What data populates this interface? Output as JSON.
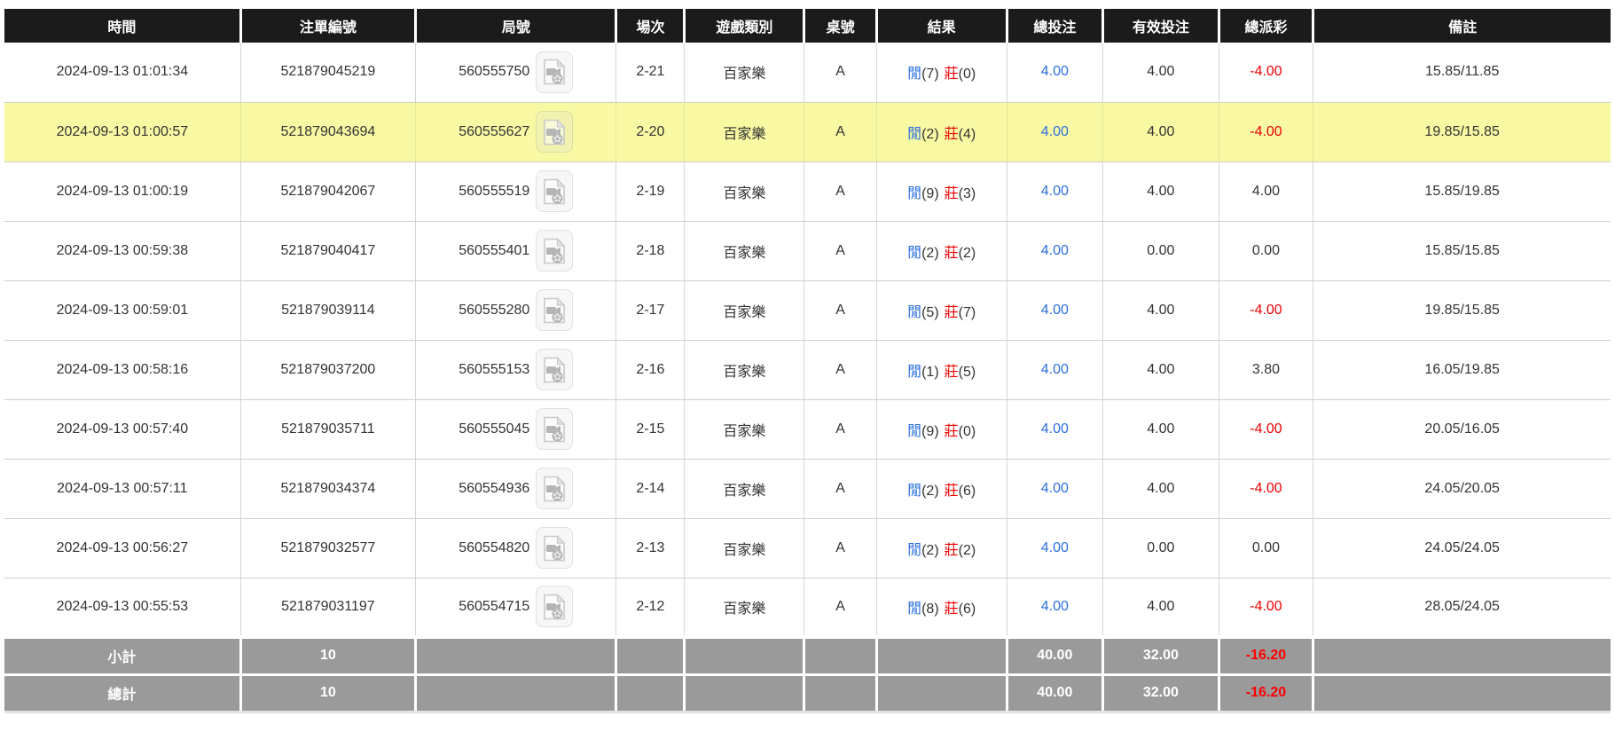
{
  "table": {
    "columns": [
      {
        "key": "time",
        "label": "時間"
      },
      {
        "key": "bet_id",
        "label": "注單編號"
      },
      {
        "key": "round",
        "label": "局號"
      },
      {
        "key": "session",
        "label": "場次"
      },
      {
        "key": "game_type",
        "label": "遊戲類別"
      },
      {
        "key": "table_no",
        "label": "桌號"
      },
      {
        "key": "result",
        "label": "結果"
      },
      {
        "key": "total_bet",
        "label": "總投注"
      },
      {
        "key": "valid_bet",
        "label": "有效投注"
      },
      {
        "key": "payout",
        "label": "總派彩"
      },
      {
        "key": "remark",
        "label": "備註"
      }
    ],
    "rows": [
      {
        "time": "2024-09-13 01:01:34",
        "bet_id": "521879045219",
        "round": "560555750",
        "session": "2-21",
        "game_type": "百家樂",
        "table_no": "A",
        "result_player": "閒",
        "result_player_score": "(7)",
        "result_banker": "莊",
        "result_banker_score": "(0)",
        "total_bet": "4.00",
        "valid_bet": "4.00",
        "payout": "-4.00",
        "remark": "15.85/11.85",
        "highlighted": false
      },
      {
        "time": "2024-09-13 01:00:57",
        "bet_id": "521879043694",
        "round": "560555627",
        "session": "2-20",
        "game_type": "百家樂",
        "table_no": "A",
        "result_player": "閒",
        "result_player_score": "(2)",
        "result_banker": "莊",
        "result_banker_score": "(4)",
        "total_bet": "4.00",
        "valid_bet": "4.00",
        "payout": "-4.00",
        "remark": "19.85/15.85",
        "highlighted": true
      },
      {
        "time": "2024-09-13 01:00:19",
        "bet_id": "521879042067",
        "round": "560555519",
        "session": "2-19",
        "game_type": "百家樂",
        "table_no": "A",
        "result_player": "閒",
        "result_player_score": "(9)",
        "result_banker": "莊",
        "result_banker_score": "(3)",
        "total_bet": "4.00",
        "valid_bet": "4.00",
        "payout": "4.00",
        "remark": "15.85/19.85",
        "highlighted": false
      },
      {
        "time": "2024-09-13 00:59:38",
        "bet_id": "521879040417",
        "round": "560555401",
        "session": "2-18",
        "game_type": "百家樂",
        "table_no": "A",
        "result_player": "閒",
        "result_player_score": "(2)",
        "result_banker": "莊",
        "result_banker_score": "(2)",
        "total_bet": "4.00",
        "valid_bet": "0.00",
        "payout": "0.00",
        "remark": "15.85/15.85",
        "highlighted": false
      },
      {
        "time": "2024-09-13 00:59:01",
        "bet_id": "521879039114",
        "round": "560555280",
        "session": "2-17",
        "game_type": "百家樂",
        "table_no": "A",
        "result_player": "閒",
        "result_player_score": "(5)",
        "result_banker": "莊",
        "result_banker_score": "(7)",
        "total_bet": "4.00",
        "valid_bet": "4.00",
        "payout": "-4.00",
        "remark": "19.85/15.85",
        "highlighted": false
      },
      {
        "time": "2024-09-13 00:58:16",
        "bet_id": "521879037200",
        "round": "560555153",
        "session": "2-16",
        "game_type": "百家樂",
        "table_no": "A",
        "result_player": "閒",
        "result_player_score": "(1)",
        "result_banker": "莊",
        "result_banker_score": "(5)",
        "total_bet": "4.00",
        "valid_bet": "4.00",
        "payout": "3.80",
        "remark": "16.05/19.85",
        "highlighted": false
      },
      {
        "time": "2024-09-13 00:57:40",
        "bet_id": "521879035711",
        "round": "560555045",
        "session": "2-15",
        "game_type": "百家樂",
        "table_no": "A",
        "result_player": "閒",
        "result_player_score": "(9)",
        "result_banker": "莊",
        "result_banker_score": "(0)",
        "total_bet": "4.00",
        "valid_bet": "4.00",
        "payout": "-4.00",
        "remark": "20.05/16.05",
        "highlighted": false
      },
      {
        "time": "2024-09-13 00:57:11",
        "bet_id": "521879034374",
        "round": "560554936",
        "session": "2-14",
        "game_type": "百家樂",
        "table_no": "A",
        "result_player": "閒",
        "result_player_score": "(2)",
        "result_banker": "莊",
        "result_banker_score": "(6)",
        "total_bet": "4.00",
        "valid_bet": "4.00",
        "payout": "-4.00",
        "remark": "24.05/20.05",
        "highlighted": false
      },
      {
        "time": "2024-09-13 00:56:27",
        "bet_id": "521879032577",
        "round": "560554820",
        "session": "2-13",
        "game_type": "百家樂",
        "table_no": "A",
        "result_player": "閒",
        "result_player_score": "(2)",
        "result_banker": "莊",
        "result_banker_score": "(2)",
        "total_bet": "4.00",
        "valid_bet": "0.00",
        "payout": "0.00",
        "remark": "24.05/24.05",
        "highlighted": false
      },
      {
        "time": "2024-09-13 00:55:53",
        "bet_id": "521879031197",
        "round": "560554715",
        "session": "2-12",
        "game_type": "百家樂",
        "table_no": "A",
        "result_player": "閒",
        "result_player_score": "(8)",
        "result_banker": "莊",
        "result_banker_score": "(6)",
        "total_bet": "4.00",
        "valid_bet": "4.00",
        "payout": "-4.00",
        "remark": "28.05/24.05",
        "highlighted": false
      }
    ],
    "footer": [
      {
        "label": "小計",
        "count": "10",
        "total_bet": "40.00",
        "valid_bet": "32.00",
        "payout": "-16.20"
      },
      {
        "label": "總計",
        "count": "10",
        "total_bet": "40.00",
        "valid_bet": "32.00",
        "payout": "-16.20"
      }
    ]
  },
  "icons": {
    "replay": "video-replay-icon"
  },
  "colors": {
    "header_bg": "#1b1b1b",
    "highlight_row": "#f9f9a3",
    "footer_bg": "#9a9a9a",
    "link_blue": "#2b6fe0",
    "negative_red": "#ee0000",
    "text": "#333333"
  }
}
